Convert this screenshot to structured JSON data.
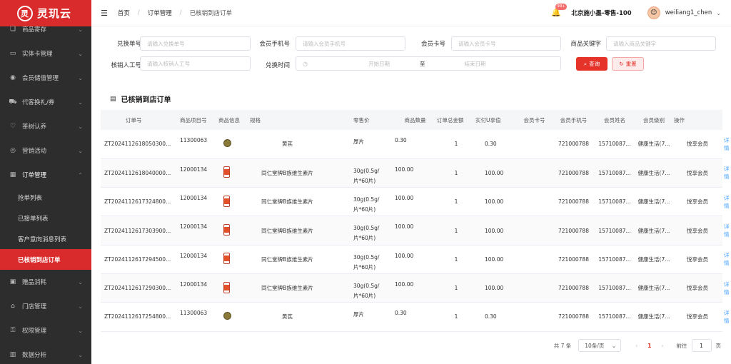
{
  "app": {
    "logo_text": "灵玑云",
    "logo_glyph": "灵"
  },
  "sidebar": {
    "items": [
      {
        "icon": "gift-icon",
        "label": "商品寄存"
      },
      {
        "icon": "card-icon",
        "label": "实体卡管理"
      },
      {
        "icon": "wallet-icon",
        "label": "会员储值管理"
      },
      {
        "icon": "cart-icon",
        "label": "代客换礼/券"
      },
      {
        "icon": "leaf-icon",
        "label": "茶树认养"
      },
      {
        "icon": "marketing-icon",
        "label": "营销活动"
      },
      {
        "icon": "grid-icon",
        "label": "订单管理"
      }
    ],
    "sub_items": [
      "抢单列表",
      "已接单列表",
      "客户意向消息列表",
      "已核销到店订单"
    ],
    "bottom_items": [
      {
        "icon": "box-icon",
        "label": "赠品消耗"
      },
      {
        "icon": "store-icon",
        "label": "门店管理"
      },
      {
        "icon": "lock-icon",
        "label": "权限管理"
      },
      {
        "icon": "chart-icon",
        "label": "数据分析"
      }
    ]
  },
  "header": {
    "breadcrumb": [
      "首页",
      "订单管理",
      "已核销到店订单"
    ],
    "bell_badge": "99+",
    "store_name": "北京施小墨-零售-100",
    "username": "weiliang1_chen"
  },
  "filters": {
    "redeem_no_label": "兑换单号",
    "redeem_no_placeholder": "请输入兑换单号",
    "member_phone_label": "会员手机号",
    "member_phone_placeholder": "请输入会员手机号",
    "member_card_label": "会员卡号",
    "member_card_placeholder": "请输入会员卡号",
    "keyword_label": "商品关键字",
    "keyword_placeholder": "请输入商品关键字",
    "verifier_label": "核销人工号",
    "verifier_placeholder": "请输入核销人工号",
    "time_label": "兑换时间",
    "start_placeholder": "开始日期",
    "range_sep": "至",
    "end_placeholder": "结束日期",
    "search_label": "查询",
    "reset_label": "重置"
  },
  "section_title": "已核销到店订单",
  "table": {
    "headers": [
      "订单号",
      "商品项目号",
      "商品信息",
      "规格",
      "零售价",
      "商品数量",
      "订单总金额",
      "实付U享值",
      "会员卡号",
      "会员手机号",
      "会员姓名",
      "会员级别",
      "操作"
    ],
    "rows": [
      {
        "order": "ZT2024112618050300...",
        "item": "11300063",
        "thumb": "herb",
        "name": "黄芪",
        "spec1": "厚片",
        "spec2": "",
        "price": "0.30",
        "qty": "1",
        "total": "0.30",
        "paid": "",
        "card": "721000788",
        "phone": "15710087...",
        "member": "健康生活(7...",
        "level": "悦享会员",
        "action": "详情"
      },
      {
        "order": "ZT2024112618040000...",
        "item": "12000134",
        "thumb": "bottle",
        "name": "同仁堂牌B族维生素片",
        "spec1": "30g(0.5g/",
        "spec2": "片*60片)",
        "price": "100.00",
        "qty": "1",
        "total": "100.00",
        "paid": "",
        "card": "721000788",
        "phone": "15710087...",
        "member": "健康生活(7...",
        "level": "悦享会员",
        "action": "详情"
      },
      {
        "order": "ZT2024112617324800...",
        "item": "12000134",
        "thumb": "bottle",
        "name": "同仁堂牌B族维生素片",
        "spec1": "30g(0.5g/",
        "spec2": "片*60片)",
        "price": "100.00",
        "qty": "1",
        "total": "100.00",
        "paid": "",
        "card": "721000788",
        "phone": "15710087...",
        "member": "健康生活(7...",
        "level": "悦享会员",
        "action": "详情"
      },
      {
        "order": "ZT2024112617303900...",
        "item": "12000134",
        "thumb": "bottle",
        "name": "同仁堂牌B族维生素片",
        "spec1": "30g(0.5g/",
        "spec2": "片*60片)",
        "price": "100.00",
        "qty": "1",
        "total": "100.00",
        "paid": "",
        "card": "721000788",
        "phone": "15710087...",
        "member": "健康生活(7...",
        "level": "悦享会员",
        "action": "详情"
      },
      {
        "order": "ZT2024112617294500...",
        "item": "12000134",
        "thumb": "bottle",
        "name": "同仁堂牌B族维生素片",
        "spec1": "30g(0.5g/",
        "spec2": "片*60片)",
        "price": "100.00",
        "qty": "1",
        "total": "100.00",
        "paid": "",
        "card": "721000788",
        "phone": "15710087...",
        "member": "健康生活(7...",
        "level": "悦享会员",
        "action": "详情"
      },
      {
        "order": "ZT2024112617290300...",
        "item": "12000134",
        "thumb": "bottle",
        "name": "同仁堂牌B族维生素片",
        "spec1": "30g(0.5g/",
        "spec2": "片*60片)",
        "price": "100.00",
        "qty": "1",
        "total": "100.00",
        "paid": "",
        "card": "721000788",
        "phone": "15710087...",
        "member": "健康生活(7...",
        "level": "悦享会员",
        "action": "详情"
      },
      {
        "order": "ZT2024112617254800...",
        "item": "11300063",
        "thumb": "herb",
        "name": "黄芪",
        "spec1": "厚片",
        "spec2": "",
        "price": "0.30",
        "qty": "1",
        "total": "0.30",
        "paid": "",
        "card": "721000788",
        "phone": "15710087...",
        "member": "健康生活(7...",
        "level": "悦享会员",
        "action": "详情"
      }
    ]
  },
  "pagination": {
    "total": "共 7 条",
    "page_size": "10条/页",
    "current": "1",
    "goto_label": "前往",
    "goto_value": "1",
    "page_unit": "页"
  },
  "colors": {
    "brand": "#d92b2b",
    "link": "#409eff"
  }
}
